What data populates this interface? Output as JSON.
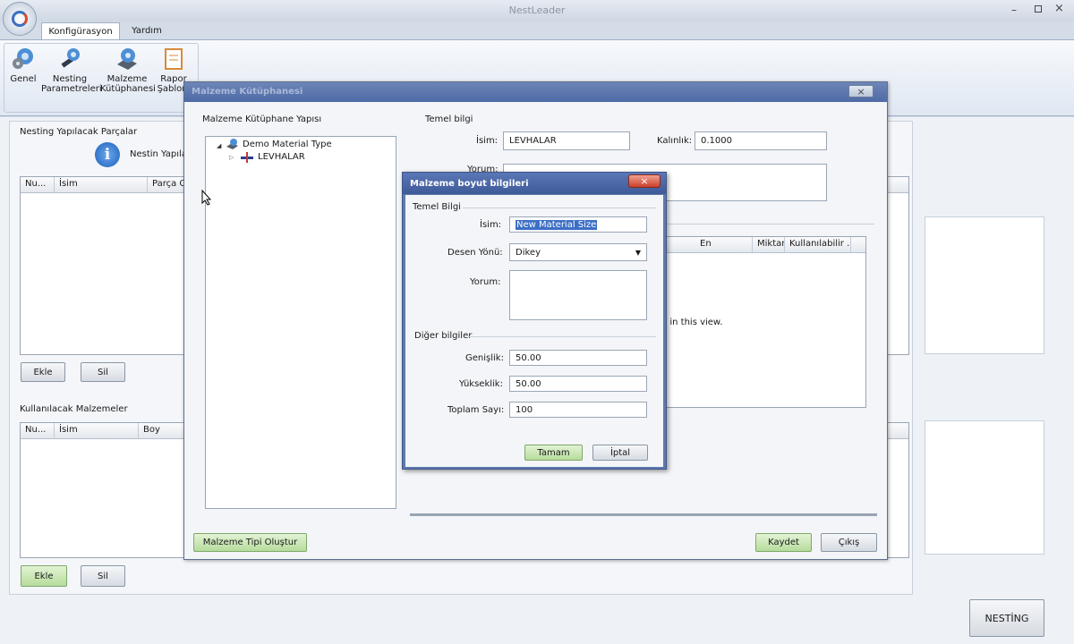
{
  "app": {
    "title": "NestLeader"
  },
  "ribbon": {
    "tabs": [
      "Konfigürasyon",
      "Yardım"
    ],
    "buttons": [
      {
        "label": "Genel",
        "icon": "gear-globe-icon"
      },
      {
        "label": "Nesting Parametreleri",
        "icon": "tools-icon"
      },
      {
        "label": "Malzeme Kütüphanesi",
        "icon": "material-gear-icon"
      },
      {
        "label": "Rapor Şablonl",
        "icon": "report-icon"
      }
    ]
  },
  "main": {
    "parts_title": "Nesting Yapılacak Parçalar",
    "info_text": "Nestin Yapıla",
    "parts_columns": [
      "Nu...",
      "İsim",
      "Parça O"
    ],
    "add_label": "Ekle",
    "delete_label": "Sil",
    "materials_title": "Kullanılacak Malzemeler",
    "materials_columns": [
      "Nu...",
      "İsim",
      "Boy"
    ],
    "nesting_button": "NESTİNG"
  },
  "library": {
    "title": "Malzeme Kütüphanesi",
    "tree_title": "Malzeme Kütüphane Yapısı",
    "tree_root": "Demo Material Type",
    "tree_child": "LEVHALAR",
    "basic_info": "Temel bilgi",
    "name_label": "İsim:",
    "name_value": "LEVHALAR",
    "thickness_label": "Kalınlık:",
    "thickness_value": "0.1000",
    "comment_label": "Yorum:",
    "grid_columns": [
      "En",
      "Miktar",
      "Kullanılabilir ..."
    ],
    "grid_empty": "w in this view.",
    "create_type_button": "Malzeme Tipi Oluştur",
    "save_button": "Kaydet",
    "exit_button": "Çıkış"
  },
  "size_dialog": {
    "title": "Malzeme boyut bilgileri",
    "basic_section": "Temel Bilgi",
    "name_label": "İsim:",
    "name_value": "New Material Size",
    "pattern_label": "Desen Yönü:",
    "pattern_value": "Dikey",
    "comment_label": "Yorum:",
    "other_section": "Diğer bilgiler",
    "width_label": "Genişlik:",
    "width_value": "50.00",
    "height_label": "Yükseklik:",
    "height_value": "50.00",
    "count_label": "Toplam Sayı:",
    "count_value": "100",
    "ok_button": "Tamam",
    "cancel_button": "İptal"
  }
}
